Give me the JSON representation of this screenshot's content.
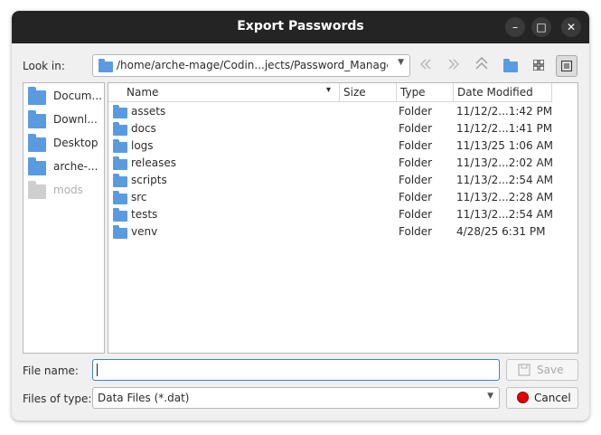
{
  "window": {
    "title": "Export Passwords",
    "minimize_glyph": "–",
    "maximize_glyph": "□",
    "close_glyph": "✕"
  },
  "look_in": {
    "label": "Look in:",
    "path": "/home/arche-mage/Codin...jects/Password_Manager"
  },
  "toolbar": {
    "back_icon": "arrow-left-icon",
    "forward_icon": "arrow-right-icon",
    "up_icon": "arrow-up-icon",
    "new_folder_icon": "new-folder-icon",
    "icon_view_icon": "grid-view-icon",
    "detail_view_icon": "list-view-icon"
  },
  "sidebar": {
    "items": [
      {
        "label": "Docum...",
        "enabled": true
      },
      {
        "label": "Downl...",
        "enabled": true
      },
      {
        "label": "Desktop",
        "enabled": true
      },
      {
        "label": "arche-...",
        "enabled": true
      },
      {
        "label": "mods",
        "enabled": false
      }
    ]
  },
  "files": {
    "columns": [
      "Name",
      "Size",
      "Type",
      "Date Modified"
    ],
    "sort_indicator": "▾",
    "rows": [
      {
        "name": "assets",
        "size": "",
        "type": "Folder",
        "date": "11/12/2...1:42 PM"
      },
      {
        "name": "docs",
        "size": "",
        "type": "Folder",
        "date": "11/12/2...1:41 PM"
      },
      {
        "name": "logs",
        "size": "",
        "type": "Folder",
        "date": "11/13/25 1:06 AM"
      },
      {
        "name": "releases",
        "size": "",
        "type": "Folder",
        "date": "11/13/2...2:02 AM"
      },
      {
        "name": "scripts",
        "size": "",
        "type": "Folder",
        "date": "11/13/2...2:54 AM"
      },
      {
        "name": "src",
        "size": "",
        "type": "Folder",
        "date": "11/13/2...2:28 AM"
      },
      {
        "name": "tests",
        "size": "",
        "type": "Folder",
        "date": "11/13/2...2:54 AM"
      },
      {
        "name": "venv",
        "size": "",
        "type": "Folder",
        "date": "4/28/25 6:31 PM"
      }
    ]
  },
  "filename": {
    "label": "File name:",
    "value": ""
  },
  "filetype": {
    "label": "Files of type:",
    "value": "Data Files (*.dat)"
  },
  "buttons": {
    "save": "Save",
    "cancel": "Cancel"
  },
  "colors": {
    "titlebar": "#242424",
    "folder": "#5a9be0",
    "cancel_icon": "#e00000",
    "focus": "#3c7fd8"
  }
}
